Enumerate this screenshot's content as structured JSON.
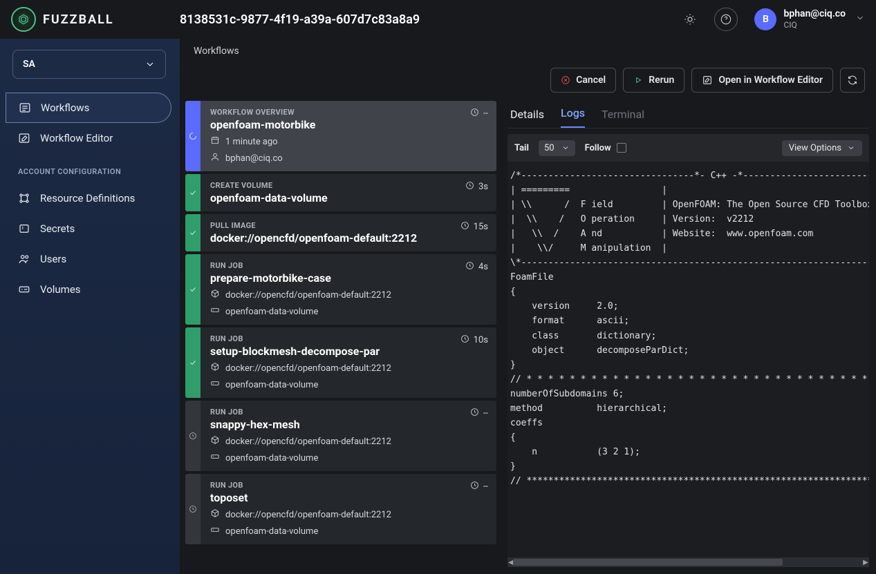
{
  "brand": {
    "name": "FUZZBALL"
  },
  "header": {
    "title": "8138531c-9877-4f19-a39a-607d7c83a8a9",
    "user": {
      "initial": "B",
      "email": "bphan@ciq.co",
      "org": "CIQ"
    }
  },
  "sidebar": {
    "tenant": "SA",
    "items": [
      {
        "label": "Workflows"
      },
      {
        "label": "Workflow Editor"
      }
    ],
    "section": "ACCOUNT CONFIGURATION",
    "configItems": [
      {
        "label": "Resource Definitions"
      },
      {
        "label": "Secrets"
      },
      {
        "label": "Users"
      },
      {
        "label": "Volumes"
      }
    ]
  },
  "breadcrumb": "Workflows",
  "actions": {
    "cancel": "Cancel",
    "rerun": "Rerun",
    "open_editor": "Open in Workflow Editor"
  },
  "steps": [
    {
      "status": "running",
      "kicker": "WORKFLOW OVERVIEW",
      "title": "openfoam-motorbike",
      "time": "--",
      "meta": [
        {
          "icon": "calendar",
          "text": "1 minute ago"
        },
        {
          "icon": "user",
          "text": "bphan@ciq.co"
        }
      ],
      "selected": true
    },
    {
      "status": "done",
      "kicker": "CREATE VOLUME",
      "title": "openfoam-data-volume",
      "time": "3s",
      "meta": []
    },
    {
      "status": "done",
      "kicker": "PULL IMAGE",
      "title": "docker://opencfd/openfoam-default:2212",
      "time": "15s",
      "meta": []
    },
    {
      "status": "done",
      "kicker": "RUN JOB",
      "title": "prepare-motorbike-case",
      "time": "4s",
      "meta": [
        {
          "icon": "cube",
          "text": "docker://opencfd/openfoam-default:2212"
        },
        {
          "icon": "disk",
          "text": "openfoam-data-volume"
        }
      ]
    },
    {
      "status": "done",
      "kicker": "RUN JOB",
      "title": "setup-blockmesh-decompose-par",
      "time": "10s",
      "meta": [
        {
          "icon": "cube",
          "text": "docker://opencfd/openfoam-default:2212"
        },
        {
          "icon": "disk",
          "text": "openfoam-data-volume"
        }
      ]
    },
    {
      "status": "pending",
      "kicker": "RUN JOB",
      "title": "snappy-hex-mesh",
      "time": "--",
      "meta": [
        {
          "icon": "cube",
          "text": "docker://opencfd/openfoam-default:2212"
        },
        {
          "icon": "disk",
          "text": "openfoam-data-volume"
        }
      ]
    },
    {
      "status": "pending",
      "kicker": "RUN JOB",
      "title": "toposet",
      "time": "--",
      "meta": [
        {
          "icon": "cube",
          "text": "docker://opencfd/openfoam-default:2212"
        },
        {
          "icon": "disk",
          "text": "openfoam-data-volume"
        }
      ]
    }
  ],
  "rightPanel": {
    "tabs": {
      "details": "Details",
      "logs": "Logs",
      "terminal": "Terminal"
    },
    "tail_label": "Tail",
    "tail_value": "50",
    "follow_label": "Follow",
    "view_options": "View Options",
    "log": "/*--------------------------------*- C++ -*----------------------------\n| =========                 |\n| \\\\      /  F ield         | OpenFOAM: The Open Source CFD Toolbox\n|  \\\\    /   O peration     | Version:  v2212\n|   \\\\  /    A nd           | Website:  www.openfoam.com\n|    \\\\/     M anipulation  |\n\\*---------------------------------------------------------------------\nFoamFile\n{\n    version     2.0;\n    format      ascii;\n    class       dictionary;\n    object      decomposeParDict;\n}\n// * * * * * * * * * * * * * * * * * * * * * * * * * * * * * * * * * *\nnumberOfSubdomains 6;\nmethod          hierarchical;\ncoeffs\n{\n    n           (3 2 1);\n}\n// *******************************************************************"
  }
}
